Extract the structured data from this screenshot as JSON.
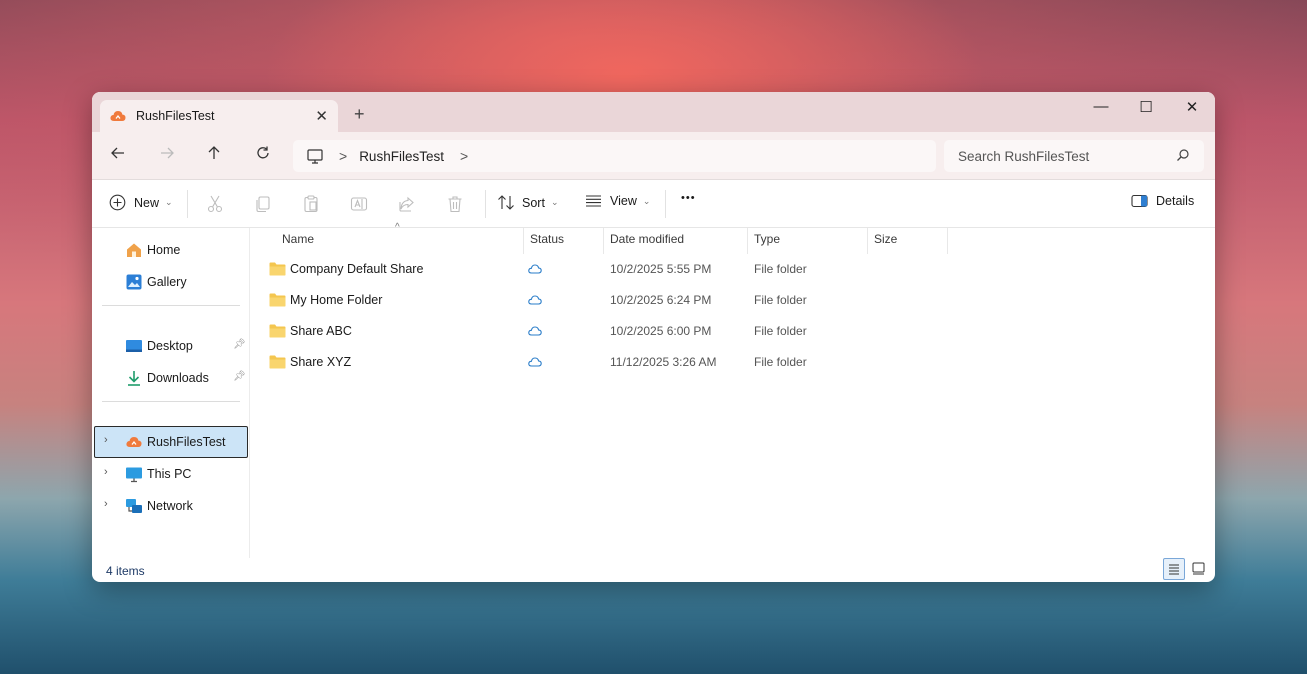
{
  "tab": {
    "title": "RushFilesTest",
    "close": "✕",
    "new_tab": "+"
  },
  "window_controls": {
    "minimize": "—",
    "maximize": "☐",
    "close": "✕"
  },
  "address": {
    "crumb": "RushFilesTest",
    "sep1": ">",
    "sep2": ">"
  },
  "search": {
    "placeholder": "Search RushFilesTest"
  },
  "toolbar": {
    "new_label": "New",
    "sort_label": "Sort",
    "view_label": "View",
    "more": "•••",
    "details_label": "Details"
  },
  "sidebar": {
    "home": "Home",
    "gallery": "Gallery",
    "desktop": "Desktop",
    "downloads": "Downloads",
    "rushfiles": "RushFilesTest",
    "thispc": "This PC",
    "network": "Network"
  },
  "columns": {
    "name": "Name",
    "status": "Status",
    "date": "Date modified",
    "type": "Type",
    "size": "Size"
  },
  "files": [
    {
      "name": "Company Default Share",
      "date": "10/2/2025 5:55 PM",
      "type": "File folder"
    },
    {
      "name": "My Home Folder",
      "date": "10/2/2025 6:24 PM",
      "type": "File folder"
    },
    {
      "name": "Share ABC",
      "date": "10/2/2025 6:00 PM",
      "type": "File folder"
    },
    {
      "name": "Share XYZ",
      "date": "11/12/2025 3:26 AM",
      "type": "File folder"
    }
  ],
  "status": {
    "count": "4 items"
  },
  "colors": {
    "accent": "#0a63c9",
    "folder": "#f4c64f",
    "rush_orange": "#f07a3c"
  }
}
